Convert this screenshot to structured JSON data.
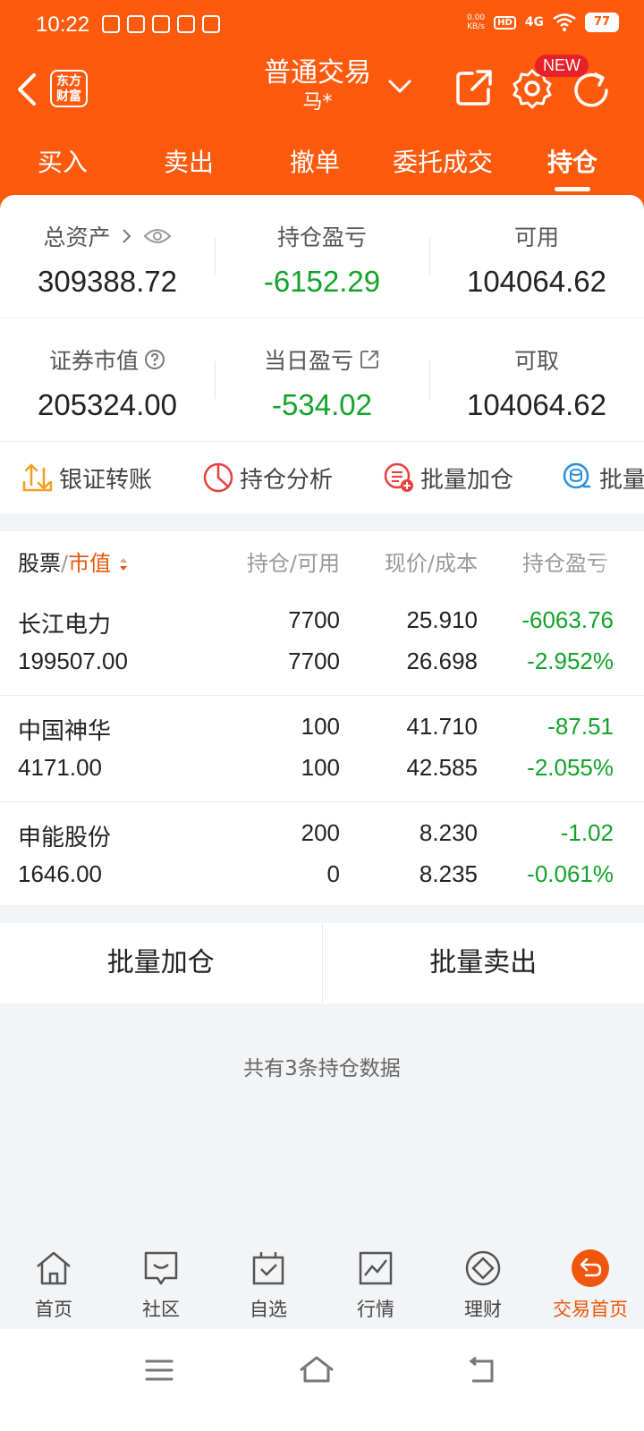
{
  "status_bar": {
    "time": "10:22",
    "net_speed_value": "0.00",
    "net_speed_unit": "KB/s",
    "hd": "HD",
    "network": "4G",
    "battery": "77"
  },
  "header": {
    "brand_logo_text_line1": "东方",
    "brand_logo_text_line2": "财富",
    "title": "普通交易",
    "account": "马*",
    "new_badge": "NEW",
    "accent_color": "#fe5a0e"
  },
  "tabs": [
    {
      "label": "买入",
      "active": false
    },
    {
      "label": "卖出",
      "active": false
    },
    {
      "label": "撤单",
      "active": false
    },
    {
      "label": "委托成交",
      "active": false
    },
    {
      "label": "持仓",
      "active": true
    }
  ],
  "summary": {
    "total_assets_label": "总资产",
    "total_assets": "309388.72",
    "position_pl_label": "持仓盈亏",
    "position_pl": "-6152.29",
    "available_label": "可用",
    "available": "104064.62",
    "market_value_label": "证券市值",
    "market_value": "205324.00",
    "daily_pl_label": "当日盈亏",
    "daily_pl": "-534.02",
    "withdrawable_label": "可取",
    "withdrawable": "104064.62"
  },
  "quick_links": [
    {
      "label": "银证转账",
      "icon": "transfer-icon"
    },
    {
      "label": "持仓分析",
      "icon": "pie-chart-icon"
    },
    {
      "label": "批量加仓",
      "icon": "batch-add-icon"
    },
    {
      "label": "批量",
      "icon": "batch-sell-icon"
    }
  ],
  "positions": {
    "header": {
      "stock": "股票",
      "separator": "/",
      "sort_by": "市值",
      "qty": "持仓/可用",
      "price": "现价/成本",
      "pl": "持仓盈亏"
    },
    "rows": [
      {
        "name": "长江电力",
        "market_value": "199507.00",
        "qty": "7700",
        "available": "7700",
        "price": "25.910",
        "cost": "26.698",
        "pl": "-6063.76",
        "pl_pct": "-2.952%"
      },
      {
        "name": "中国神华",
        "market_value": "4171.00",
        "qty": "100",
        "available": "100",
        "price": "41.710",
        "cost": "42.585",
        "pl": "-87.51",
        "pl_pct": "-2.055%"
      },
      {
        "name": "申能股份",
        "market_value": "1646.00",
        "qty": "200",
        "available": "0",
        "price": "8.230",
        "cost": "8.235",
        "pl": "-1.02",
        "pl_pct": "-0.061%"
      }
    ],
    "loss_color": "#12a32a"
  },
  "batch": {
    "add_label": "批量加仓",
    "sell_label": "批量卖出"
  },
  "count_text": "共有3条持仓数据",
  "bottom_nav": [
    {
      "label": "首页",
      "icon": "home-icon",
      "active": false
    },
    {
      "label": "社区",
      "icon": "chat-icon",
      "active": false
    },
    {
      "label": "自选",
      "icon": "favorites-icon",
      "active": false
    },
    {
      "label": "行情",
      "icon": "market-icon",
      "active": false
    },
    {
      "label": "理财",
      "icon": "wealth-icon",
      "active": false
    },
    {
      "label": "交易首页",
      "icon": "trade-home-icon",
      "active": true
    }
  ]
}
